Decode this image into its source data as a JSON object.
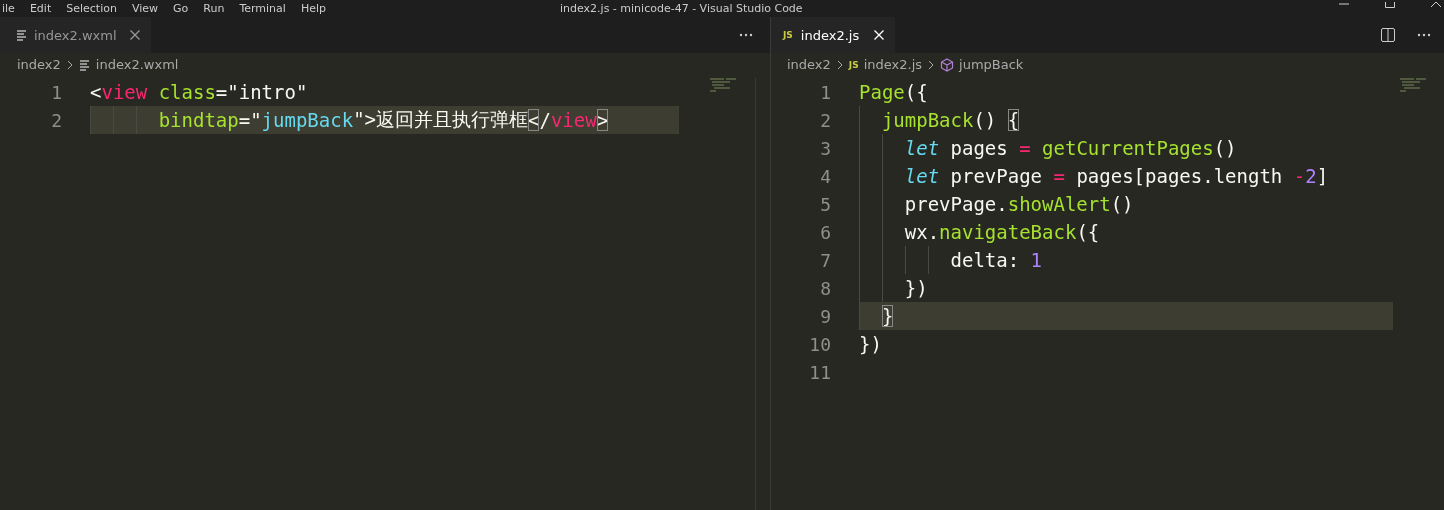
{
  "menu_bar": [
    "ile",
    "Edit",
    "Selection",
    "View",
    "Go",
    "Run",
    "Terminal",
    "Help"
  ],
  "window": {
    "title": "index2.js - minicode-47 - Visual Studio Code"
  },
  "editor_groups": [
    {
      "focused": false,
      "tabs": [
        {
          "label": "index2.wxml",
          "kind": "lines",
          "selected": true
        }
      ],
      "breadcrumbs": [
        {
          "label": "index2",
          "kind": "folder"
        },
        {
          "label": "index2.wxml",
          "kind": "lines"
        }
      ],
      "lines": [
        {
          "number": "1",
          "current": false,
          "tokens": [
            {
              "t": "<",
              "kind": "plain"
            },
            {
              "t": "view",
              "kind": "tag"
            },
            {
              "t": " class",
              "kind": "attr"
            },
            {
              "t": "=\"intro\"",
              "kind": "plain"
            }
          ]
        },
        {
          "number": "2",
          "current": true,
          "tokens": [
            {
              "t": "      bindtap",
              "kind": "attr"
            },
            {
              "t": "=\"",
              "kind": "plain"
            },
            {
              "t": "jumpBack",
              "kind": "string"
            },
            {
              "t": "\">返回并且执行弹框",
              "kind": "plain"
            },
            {
              "t": "<",
              "kind": "match"
            },
            {
              "t": "/",
              "kind": "plain"
            },
            {
              "t": "view",
              "kind": "tag"
            },
            {
              "t": ">",
              "kind": "match"
            }
          ]
        }
      ]
    },
    {
      "focused": true,
      "tabs": [
        {
          "label": "index2.js",
          "kind": "js",
          "icon_text": "JS",
          "selected": true
        }
      ],
      "breadcrumbs": [
        {
          "label": "index2",
          "kind": "folder"
        },
        {
          "label": "index2.js",
          "kind": "js",
          "icon_text": "JS"
        },
        {
          "label": "jumpBack",
          "kind": "method"
        }
      ],
      "lines": [
        {
          "number": "1",
          "current": false,
          "tokens": [
            {
              "t": "Page",
              "kind": "func"
            },
            {
              "t": "({",
              "kind": "plain"
            }
          ]
        },
        {
          "number": "2",
          "current": false,
          "tokens": [
            {
              "t": "  jumpBack",
              "kind": "func"
            },
            {
              "t": "() ",
              "kind": "plain"
            },
            {
              "t": "{",
              "kind": "match"
            }
          ]
        },
        {
          "number": "3",
          "current": false,
          "tokens": [
            {
              "t": "    let",
              "kind": "keyword"
            },
            {
              "t": " pages ",
              "kind": "plain"
            },
            {
              "t": "=",
              "kind": "operator"
            },
            {
              "t": " getCurrentPages",
              "kind": "func"
            },
            {
              "t": "()",
              "kind": "plain"
            }
          ]
        },
        {
          "number": "4",
          "current": false,
          "tokens": [
            {
              "t": "    let",
              "kind": "keyword"
            },
            {
              "t": " prevPage ",
              "kind": "plain"
            },
            {
              "t": "=",
              "kind": "operator"
            },
            {
              "t": " pages[pages.length ",
              "kind": "plain"
            },
            {
              "t": "-",
              "kind": "operator"
            },
            {
              "t": "2",
              "kind": "number"
            },
            {
              "t": "]",
              "kind": "plain"
            }
          ]
        },
        {
          "number": "5",
          "current": false,
          "tokens": [
            {
              "t": "    prevPage.",
              "kind": "plain"
            },
            {
              "t": "showAlert",
              "kind": "func"
            },
            {
              "t": "()",
              "kind": "plain"
            }
          ]
        },
        {
          "number": "6",
          "current": false,
          "tokens": [
            {
              "t": "    wx.",
              "kind": "plain"
            },
            {
              "t": "navigateBack",
              "kind": "func"
            },
            {
              "t": "({",
              "kind": "plain"
            }
          ]
        },
        {
          "number": "7",
          "current": false,
          "tokens": [
            {
              "t": "        delta: ",
              "kind": "plain"
            },
            {
              "t": "1",
              "kind": "number"
            }
          ]
        },
        {
          "number": "8",
          "current": false,
          "tokens": [
            {
              "t": "    })",
              "kind": "plain"
            }
          ]
        },
        {
          "number": "9",
          "current": true,
          "tokens": [
            {
              "t": "  }",
              "kind": "match"
            }
          ]
        },
        {
          "number": "10",
          "current": false,
          "tokens": [
            {
              "t": "})",
              "kind": "plain"
            }
          ]
        },
        {
          "number": "11",
          "current": false
        }
      ]
    }
  ]
}
